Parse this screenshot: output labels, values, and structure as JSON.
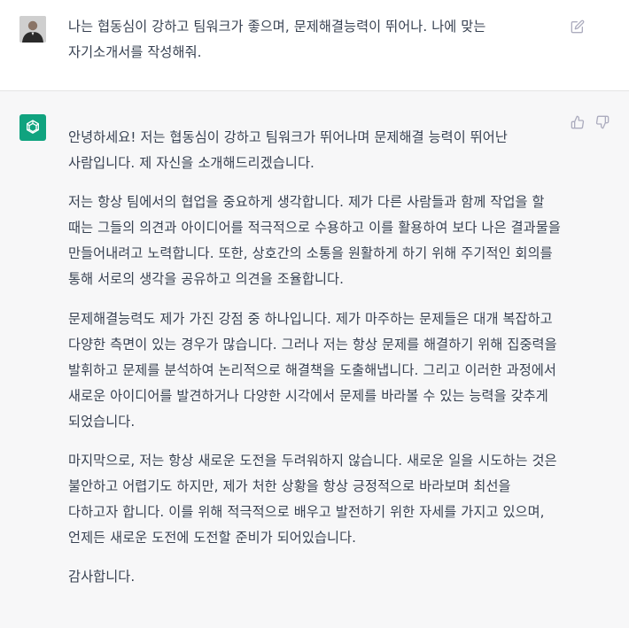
{
  "conversation": {
    "user_message": "나는 협동심이 강하고 팀워크가 좋으며, 문제해결능력이 뛰어나. 나에 맞는 자기소개서를 작성해줘.",
    "assistant_paragraphs": [
      "안녕하세요! 저는 협동심이 강하고 팀워크가 뛰어나며 문제해결 능력이 뛰어난 사람입니다. 제 자신을 소개해드리겠습니다.",
      "저는 항상 팀에서의 협업을 중요하게 생각합니다. 제가 다른 사람들과 함께 작업을 할 때는 그들의 의견과 아이디어를 적극적으로 수용하고 이를 활용하여 보다 나은 결과물을 만들어내려고 노력합니다. 또한, 상호간의 소통을 원활하게 하기 위해 주기적인 회의를 통해 서로의 생각을 공유하고 의견을 조율합니다.",
      "문제해결능력도 제가 가진 강점 중 하나입니다. 제가 마주하는 문제들은 대개 복잡하고 다양한 측면이 있는 경우가 많습니다. 그러나 저는 항상 문제를 해결하기 위해 집중력을 발휘하고 문제를 분석하여 논리적으로 해결책을 도출해냅니다. 그리고 이러한 과정에서 새로운 아이디어를 발견하거나 다양한 시각에서 문제를 바라볼 수 있는 능력을 갖추게 되었습니다.",
      "마지막으로, 저는 항상 새로운 도전을 두려워하지 않습니다. 새로운 일을 시도하는 것은 불안하고 어렵기도 하지만, 제가 처한 상황을 항상 긍정적으로 바라보며 최선을 다하고자 합니다. 이를 위해 적극적으로 배우고 발전하기 위한 자세를 가지고 있으며, 언제든 새로운 도전에 도전할 준비가 되어있습니다.",
      "감사합니다."
    ]
  },
  "icons": {
    "user_avatar": "user-avatar",
    "assistant_avatar": "openai-logo-icon",
    "edit": "edit-icon",
    "thumbs_up": "thumbs-up-icon",
    "thumbs_down": "thumbs-down-icon"
  },
  "colors": {
    "assistant_bg": "#f7f7f8",
    "brand_green": "#10a37f",
    "text": "#374151",
    "icon": "#acacbe"
  }
}
